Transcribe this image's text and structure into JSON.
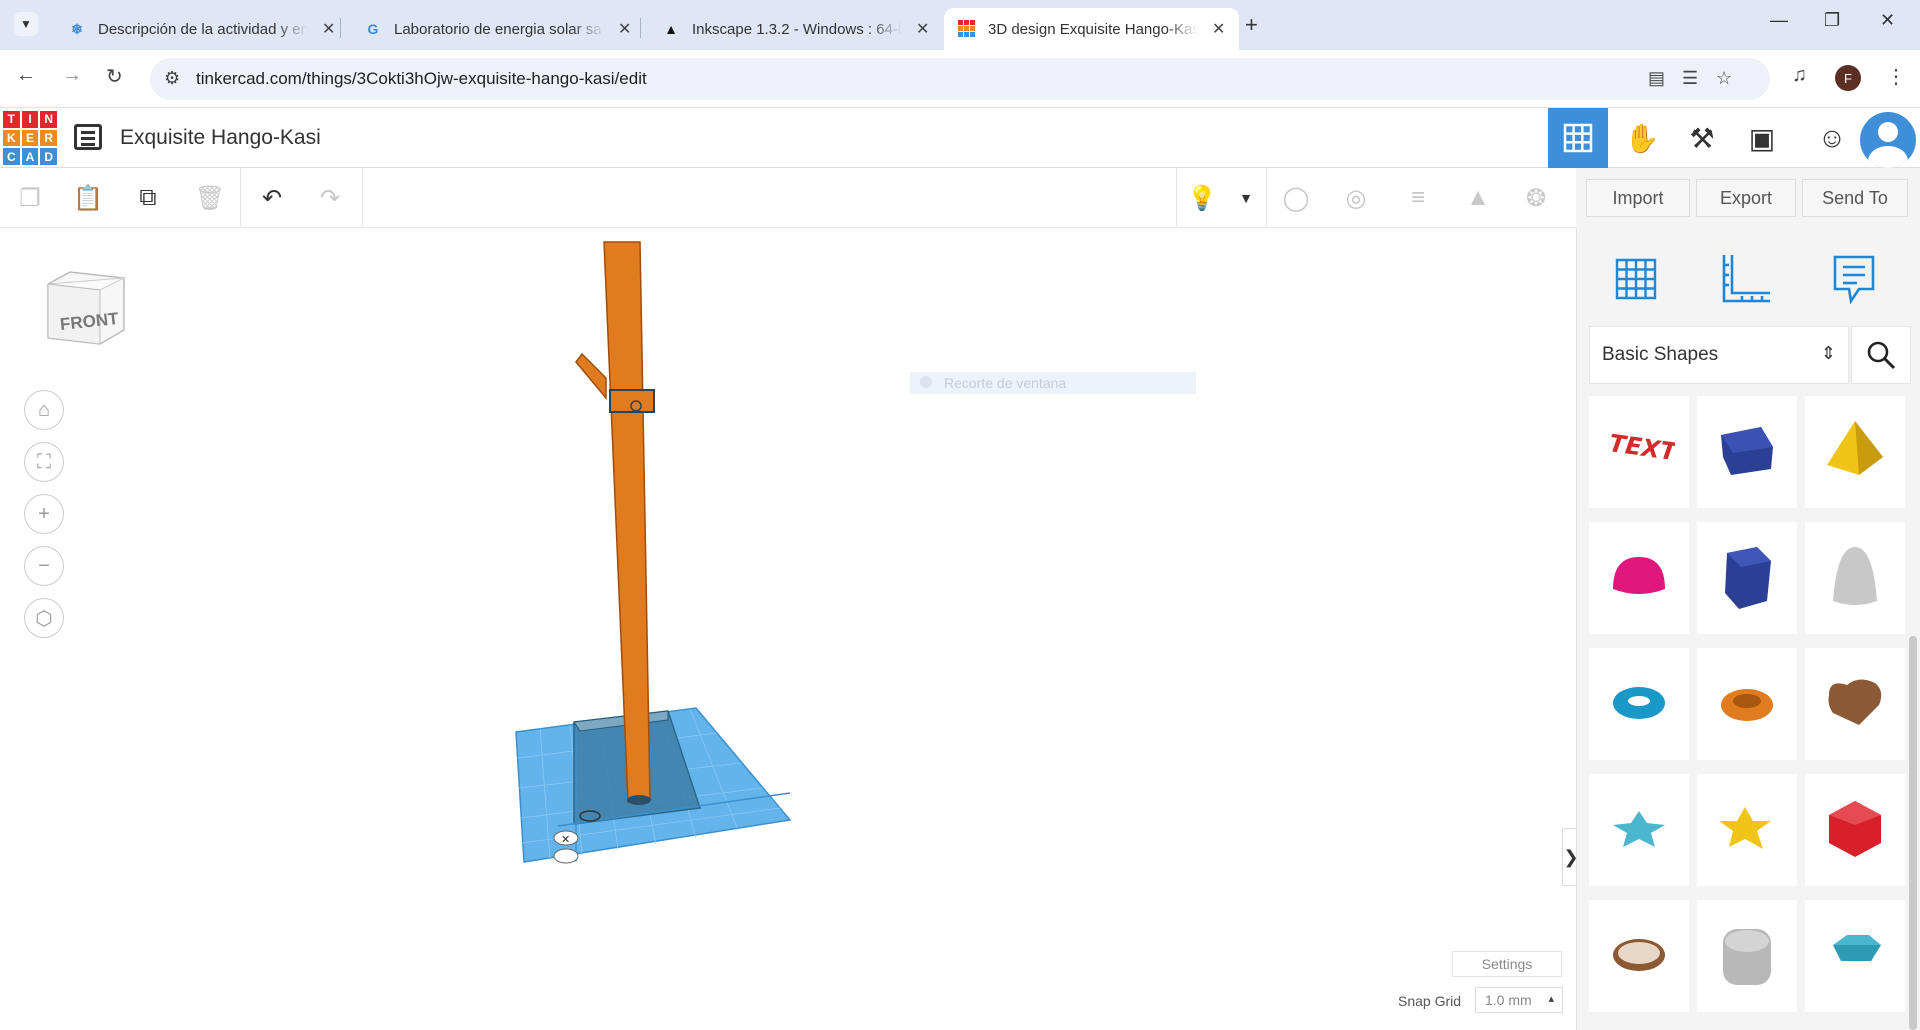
{
  "browser": {
    "tabs": [
      {
        "title": "Descripción de la actividad y en",
        "favicon": "snowflake-icon",
        "active": false
      },
      {
        "title": "Laboratorio de energia solar sa",
        "favicon": "google-icon",
        "active": false
      },
      {
        "title": "Inkscape 1.3.2 - Windows : 64-b",
        "favicon": "inkscape-icon",
        "active": false
      },
      {
        "title": "3D design Exquisite Hango-Kas",
        "favicon": "tinkercad-icon",
        "active": true
      }
    ],
    "url": "tinkercad.com/things/3Cokti3hOjw-exquisite-hango-kasi/edit",
    "profile_initial": "F"
  },
  "app": {
    "logo_letters": [
      "T",
      "I",
      "N",
      "K",
      "E",
      "R",
      "C",
      "A",
      "D"
    ],
    "logo_colors": [
      "#e2282e",
      "#e2282e",
      "#e2282e",
      "#f08a1c",
      "#f08a1c",
      "#f08a1c",
      "#3e8ed8",
      "#3e8ed8",
      "#3e8ed8"
    ],
    "design_title": "Exquisite Hango-Kasi",
    "accent": "#3e8ed8"
  },
  "actions": {
    "import": "Import",
    "export": "Export",
    "send_to": "Send To"
  },
  "viewport": {
    "viewcube_label": "FRONT",
    "overlay_text": "Recorte de ventana",
    "settings": "Settings",
    "snap_label": "Snap Grid",
    "snap_value": "1.0 mm",
    "object_color": "#e07b1f",
    "workplane_color": "#4aa8e8"
  },
  "library": {
    "category": "Basic Shapes",
    "shapes": [
      {
        "name": "text-shape",
        "color": "#d32a2a"
      },
      {
        "name": "box-shape",
        "color": "#2b3f95"
      },
      {
        "name": "pyramid-shape",
        "color": "#f0c419"
      },
      {
        "name": "half-sphere-shape",
        "color": "#e0187d"
      },
      {
        "name": "polygon-shape",
        "color": "#2b3f95"
      },
      {
        "name": "paraboloid-shape",
        "color": "#c8c8c8"
      },
      {
        "name": "torus-shape",
        "color": "#1a98c8"
      },
      {
        "name": "tube-shape",
        "color": "#e07b1f"
      },
      {
        "name": "heart-shape",
        "color": "#8b5a35"
      },
      {
        "name": "star-shape",
        "color": "#4bb7cf"
      },
      {
        "name": "star-yellow-shape",
        "color": "#f0c419"
      },
      {
        "name": "icosahedron-shape",
        "color": "#d7202a"
      },
      {
        "name": "ring-shape",
        "color": "#8b5a35"
      },
      {
        "name": "rounded-cube-shape",
        "color": "#b8b8b8"
      },
      {
        "name": "gem-shape",
        "color": "#4bb7cf"
      }
    ]
  }
}
